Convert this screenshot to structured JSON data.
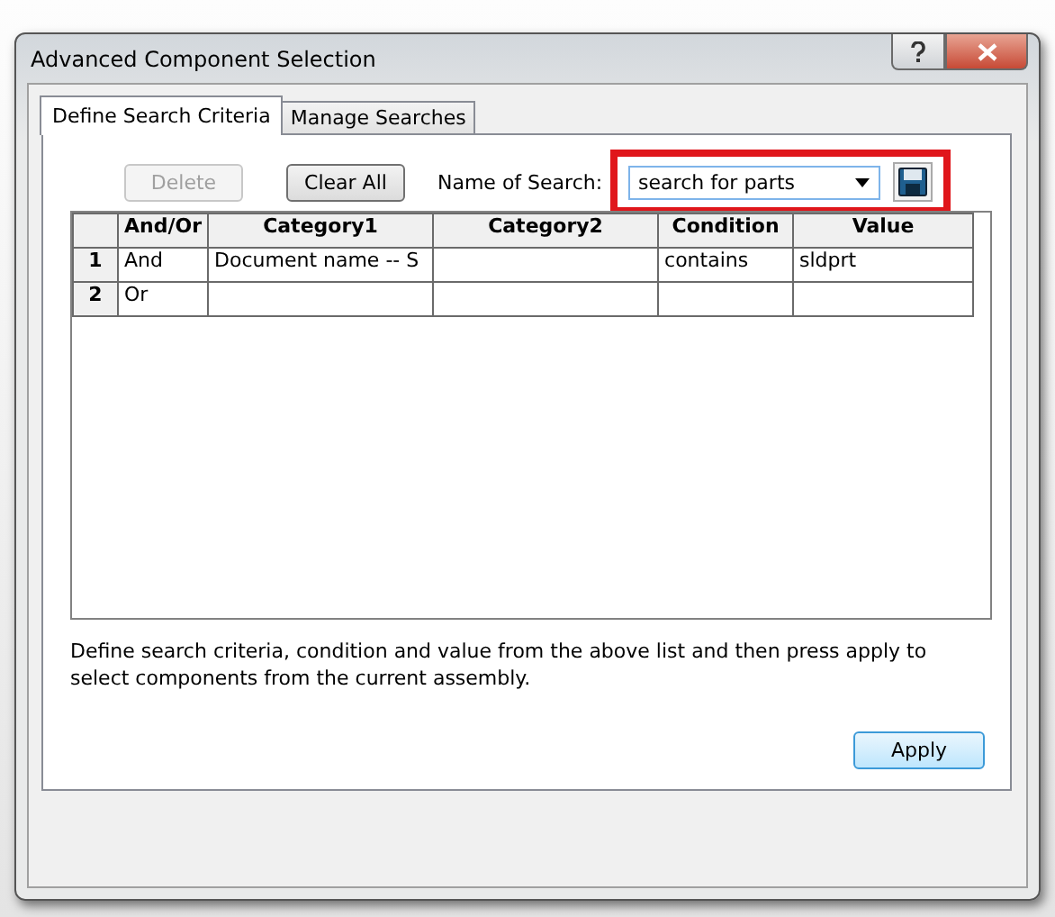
{
  "window": {
    "title": "Advanced Component Selection"
  },
  "tabs": [
    {
      "label": "Define Search Criteria",
      "selected": true
    },
    {
      "label": "Manage Searches",
      "selected": false
    }
  ],
  "toolbar": {
    "buttons": [
      {
        "label": "Delete",
        "disabled": true
      },
      {
        "label": "Clear All",
        "disabled": false
      }
    ],
    "search_name_label": "Name of Search:",
    "search_name": {
      "value": "search for parts"
    },
    "highlighted": true
  },
  "table": {
    "columns": [
      "And/Or",
      "Category1",
      "Category2",
      "Condition",
      "Value"
    ],
    "rows": [
      {
        "number": "1",
        "cells": [
          "And",
          "Document name -- S",
          "",
          "contains",
          "sldprt"
        ]
      },
      {
        "number": "2",
        "cells": [
          "Or",
          "",
          "",
          "",
          ""
        ]
      }
    ]
  },
  "description": "Define search criteria, condition and value from the above list and then press apply to select components from the current assembly.",
  "buttons": [
    {
      "label": "Apply",
      "disabled": false
    }
  ]
}
